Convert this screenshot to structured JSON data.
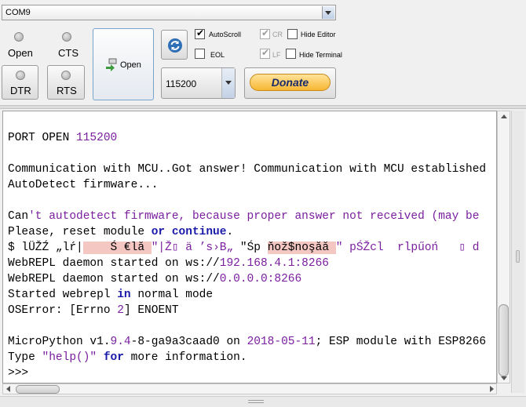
{
  "port": {
    "value": "COM9"
  },
  "signals": {
    "open_label": "Open",
    "cts_label": "CTS",
    "dtr_label": "DTR",
    "rts_label": "RTS"
  },
  "open_button": {
    "label": "Open"
  },
  "baud": {
    "value": "115200"
  },
  "options": {
    "autoscroll": "AutoScroll",
    "cr": "CR",
    "hide_editor": "Hide Editor",
    "eol": "EOL",
    "lf": "LF",
    "hide_terminal": "Hide Terminal"
  },
  "donate": {
    "label": "Donate"
  },
  "terminal": {
    "l1a": "PORT OPEN ",
    "l1b": "115200",
    "l2": "Communication with MCU..Got answer! Communication with MCU established",
    "l3": "AutoDetect firmware...",
    "l4a": "Can",
    "l4b": "'t autodetect firmware, because proper answer not received (may be",
    "l5a": "Please, reset module ",
    "l5b": "or",
    "l5c": " ",
    "l5d": "continue",
    "l5e": ".",
    "l6a": "$ lÜŽŹ „lŕ|",
    "l6b": "    Ś €lă ",
    "l6c": "\"|Ž▯ ä ’s›B„ ",
    "l6d": "\"Śp ",
    "l6e": "ňož$noşăă ",
    "l6f": "\" pŚŽcl  rlpűoń   ▯ d",
    "l7a": "WebREPL daemon started on ws://",
    "l7b": "192.168.4.1:8266",
    "l8a": "WebREPL daemon started on ws://",
    "l8b": "0.0.0.0:8266",
    "l9a": "Started webrepl ",
    "l9b": "in",
    "l9c": " normal mode",
    "l10a": "OSError: [Errno ",
    "l10b": "2",
    "l10c": "] ENOENT",
    "l11a": "MicroPython v1.",
    "l11b": "9.4",
    "l11c": "-8-ga9a3caad0 on ",
    "l11d": "2018-05-11",
    "l11e": "; ESP module with ESP8266",
    "l12a": "Type ",
    "l12b": "\"help()\"",
    "l12c": " ",
    "l12d": "for",
    "l12e": " more information.",
    "l13": ">>> "
  }
}
